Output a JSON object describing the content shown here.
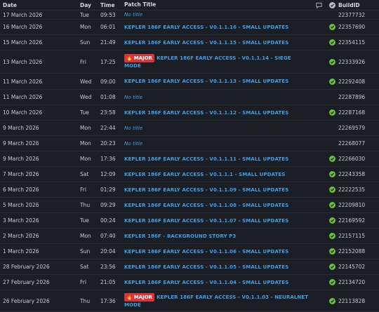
{
  "header": {
    "date": "Date",
    "day": "Day",
    "time": "Time",
    "patch_title": "Patch Title",
    "comment_icon": "comment-icon",
    "verified_icon": "check-circle-icon",
    "build_id": "BuildID"
  },
  "colors": {
    "background": "#1b1e24",
    "link": "#3ea0e8",
    "badge": "#d8343a",
    "check": "#6abf3b"
  },
  "rows": [
    {
      "date": "17 March 2026",
      "day": "Tue",
      "time": "09:53",
      "badge": "",
      "title": "No title",
      "no_title": true,
      "verified": false,
      "build": "22377732"
    },
    {
      "date": "16 March 2026",
      "day": "Mon",
      "time": "06:01",
      "badge": "",
      "title": "KEPLER 186F EARLY ACCESS - V0.1.1.16 - SMALL UPDATES",
      "no_title": false,
      "verified": true,
      "build": "22357690"
    },
    {
      "date": "15 March 2026",
      "day": "Sun",
      "time": "21:49",
      "badge": "",
      "title": "KEPLER 186F EARLY ACCESS - V0.1.1.15 - SMALL UPDATES",
      "no_title": false,
      "verified": true,
      "build": "22354115"
    },
    {
      "date": "13 March 2026",
      "day": "Fri",
      "time": "17:25",
      "badge": "MAJOR",
      "title": "KEPLER 186F EARLY ACCESS - V0.1.1.14 - SIEGE MODE",
      "no_title": false,
      "verified": true,
      "build": "22333926"
    },
    {
      "date": "11 March 2026",
      "day": "Wed",
      "time": "09:00",
      "badge": "",
      "title": "KEPLER 186F EARLY ACCESS - V0.1.1.13 - SMALL UPDATES",
      "no_title": false,
      "verified": true,
      "build": "22292408"
    },
    {
      "date": "11 March 2026",
      "day": "Wed",
      "time": "01:08",
      "badge": "",
      "title": "No title",
      "no_title": true,
      "verified": false,
      "build": "22287896"
    },
    {
      "date": "10 March 2026",
      "day": "Tue",
      "time": "23:58",
      "badge": "",
      "title": "KEPLER 186F EARLY ACCESS - V0.1.1.12 - SMALL UPDATES",
      "no_title": false,
      "verified": true,
      "build": "22287168"
    },
    {
      "date": "9 March 2026",
      "day": "Mon",
      "time": "22:44",
      "badge": "",
      "title": "No title",
      "no_title": true,
      "verified": false,
      "build": "22269579"
    },
    {
      "date": "9 March 2026",
      "day": "Mon",
      "time": "20:23",
      "badge": "",
      "title": "No title",
      "no_title": true,
      "verified": false,
      "build": "22268077"
    },
    {
      "date": "9 March 2026",
      "day": "Mon",
      "time": "17:36",
      "badge": "",
      "title": "KEPLER 186F EARLY ACCESS - V0.1.1.11 - SMALL UPDATES",
      "no_title": false,
      "verified": true,
      "build": "22266030"
    },
    {
      "date": "7 March 2026",
      "day": "Sat",
      "time": "12:09",
      "badge": "",
      "title": "KEPLER 186F EARLY ACCESS - V0.1.1.1 - SMALL UPDATES",
      "no_title": false,
      "verified": true,
      "build": "22243358"
    },
    {
      "date": "6 March 2026",
      "day": "Fri",
      "time": "01:29",
      "badge": "",
      "title": "KEPLER 186F EARLY ACCESS - V0.1.1.09 - SMALL UPDATES",
      "no_title": false,
      "verified": true,
      "build": "22222535"
    },
    {
      "date": "5 March 2026",
      "day": "Thu",
      "time": "09:29",
      "badge": "",
      "title": "KEPLER 186F EARLY ACCESS - V0.1.1.08 - SMALL UPDATES",
      "no_title": false,
      "verified": true,
      "build": "22209810"
    },
    {
      "date": "3 March 2026",
      "day": "Tue",
      "time": "00:24",
      "badge": "",
      "title": "KEPLER 186F EARLY ACCESS - V0.1.1.07 - SMALL UPDATES",
      "no_title": false,
      "verified": true,
      "build": "22169592"
    },
    {
      "date": "2 March 2026",
      "day": "Mon",
      "time": "07:40",
      "badge": "",
      "title": "KEPLER 186F - BACKGROUND STORY P3",
      "no_title": false,
      "verified": true,
      "build": "22157115"
    },
    {
      "date": "1 March 2026",
      "day": "Sun",
      "time": "20:04",
      "badge": "",
      "title": "KEPLER 186F EARLY ACCESS - V0.1.1.06 - SMALL UPDATES",
      "no_title": false,
      "verified": true,
      "build": "22152088"
    },
    {
      "date": "28 February 2026",
      "day": "Sat",
      "time": "23:56",
      "badge": "",
      "title": "KEPLER 186F EARLY ACCESS - V0.1.1.05 - SMALL UPDATES",
      "no_title": false,
      "verified": true,
      "build": "22145702"
    },
    {
      "date": "27 February 2026",
      "day": "Fri",
      "time": "21:05",
      "badge": "",
      "title": "KEPLER 186F EARLY ACCESS - V0.1.1.04 - SMALL UPDATES",
      "no_title": false,
      "verified": true,
      "build": "22134720"
    },
    {
      "date": "26 February 2026",
      "day": "Thu",
      "time": "17:36",
      "badge": "MAJOR",
      "title": "KEPLER 186F EARLY ACCESS - V0.1.1.03 - NEURALNET MODE",
      "no_title": false,
      "verified": true,
      "build": "22113828"
    }
  ]
}
